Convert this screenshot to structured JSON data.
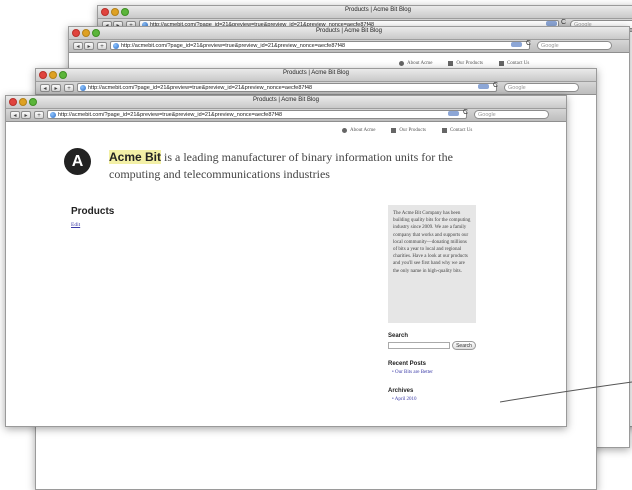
{
  "window": {
    "title": "Products | Acme Bit Blog",
    "url": "http://acmebit.com/?page_id=21&preview=true&preview_id=21&preview_nonce=aecfe87f48",
    "nav_back": "◂",
    "nav_forward": "▸",
    "add": "+",
    "reload": "C",
    "search_placeholder": "Google"
  },
  "subnav": {
    "items": [
      {
        "label": "About Acme",
        "icon": "gear-icon"
      },
      {
        "label": "Our Products",
        "icon": "box-icon"
      },
      {
        "label": "Contact Us",
        "icon": "phone-icon"
      }
    ]
  },
  "page": {
    "logo_letter": "A",
    "brand": "Acme Bit",
    "tagline": " is a leading manufacturer of binary information units for the computing and telecommunications industries",
    "heading": "Products",
    "edit_link": "Edit"
  },
  "sidebar": {
    "about_text": "The Acme Bit Company has been building quality bits for the computing industry since 2009. We are a family company that works and supports our local community—donating millions of bits a year to local and regional charities. Have a look at our products and you'll see first hand why we are the only name in high-quality bits.",
    "search_heading": "Search",
    "search_button": "Search",
    "recent_heading": "Recent Posts",
    "recent_posts": [
      "Our Bits are Better"
    ],
    "archives_heading": "Archives",
    "archives": [
      "April 2010"
    ]
  }
}
